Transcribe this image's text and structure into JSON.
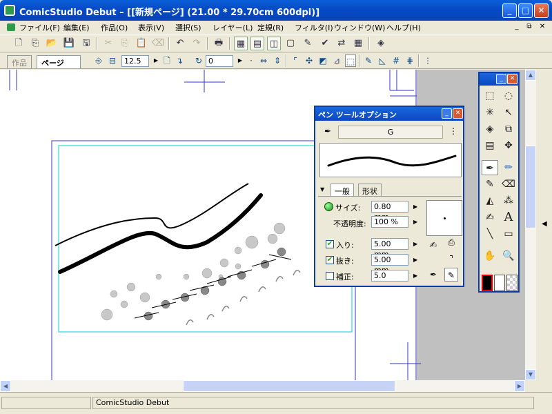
{
  "window": {
    "title": "ComicStudio Debut – [[新規ページ] (21.00 * 29.70cm 600dpi)]",
    "minimize": "_",
    "maximize": "□",
    "close": "✕"
  },
  "menubar": {
    "items": [
      "ファイル(F)",
      "編集(E)",
      "作品(O)",
      "表示(V)",
      "選択(S)",
      "レイヤー(L)",
      "定規(R)",
      "フィルタ(I)",
      "ウィンドウ(W)",
      "ヘルプ(H)"
    ],
    "mdi_min": "_",
    "mdi_restore": "⧉",
    "mdi_close": "✕"
  },
  "doc_tabs": {
    "story_tab": "作品",
    "page_tab": "ページ",
    "page_close": "✕",
    "zoom_value": "12.5",
    "rotate_value": "0"
  },
  "pen_panel": {
    "title": "ペン ツールオプション",
    "brush_name": "G",
    "tabs": [
      "一般",
      "形状"
    ],
    "size_label": "サイズ:",
    "size_value": "0.80 mm",
    "opacity_label": "不透明度:",
    "opacity_value": "100 %",
    "entry_label": "入り:",
    "entry_value": "5.00 mm",
    "entry_checked": true,
    "exit_label": "抜き:",
    "exit_value": "5.00 mm",
    "exit_checked": true,
    "correction_label": "補正:",
    "correction_value": "5.0",
    "correction_checked": false
  },
  "statusbar": {
    "app_name": "ComicStudio Debut"
  },
  "icons": {
    "new": "new-page-icon",
    "open": "open-icon",
    "save": "save-icon",
    "print": "print-icon",
    "undo": "undo-icon",
    "redo": "redo-icon",
    "pen": "pen-icon",
    "eraser": "eraser-icon",
    "hand": "hand-icon",
    "zoom": "zoom-icon",
    "text": "text-icon"
  },
  "colors": {
    "titlebar": "#0a5fd8",
    "canvas_guide_blue": "#3333cc",
    "canvas_guide_cyan": "#00d0d0",
    "foreground": "#000000",
    "background": "#ffffff"
  }
}
